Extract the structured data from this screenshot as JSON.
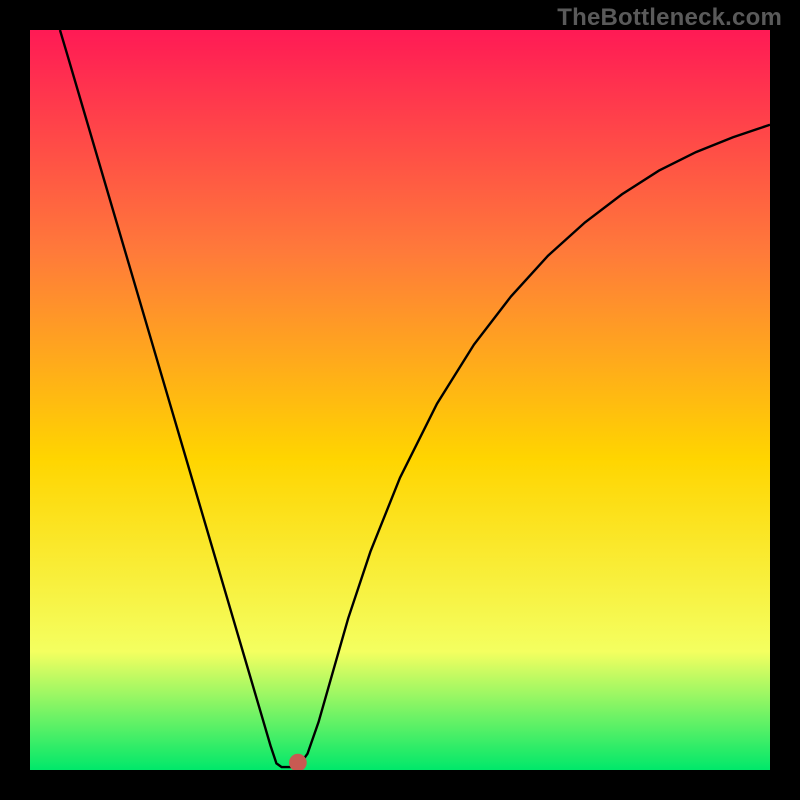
{
  "watermark": "TheBottleneck.com",
  "chart_data": {
    "type": "line",
    "title": "",
    "xlabel": "",
    "ylabel": "",
    "xlim": [
      0,
      100
    ],
    "ylim": [
      0,
      100
    ],
    "gradient_colors": {
      "top": "#ff1a55",
      "upper_mid": "#ff7a3a",
      "mid": "#ffd500",
      "lower_mid": "#f4ff60",
      "bottom": "#00e86a"
    },
    "series": [
      {
        "name": "curve",
        "stroke": "#000000",
        "stroke_width": 2.4,
        "points": [
          {
            "x": 4.05,
            "y": 100.0
          },
          {
            "x": 5.0,
            "y": 96.8
          },
          {
            "x": 7.0,
            "y": 90.0
          },
          {
            "x": 10.0,
            "y": 79.8
          },
          {
            "x": 13.0,
            "y": 69.6
          },
          {
            "x": 16.0,
            "y": 59.4
          },
          {
            "x": 19.0,
            "y": 49.2
          },
          {
            "x": 22.0,
            "y": 39.0
          },
          {
            "x": 25.0,
            "y": 28.8
          },
          {
            "x": 27.0,
            "y": 22.0
          },
          {
            "x": 29.0,
            "y": 15.2
          },
          {
            "x": 31.0,
            "y": 8.4
          },
          {
            "x": 32.5,
            "y": 3.3
          },
          {
            "x": 33.3,
            "y": 0.9
          },
          {
            "x": 34.0,
            "y": 0.4
          },
          {
            "x": 35.5,
            "y": 0.4
          },
          {
            "x": 36.5,
            "y": 0.8
          },
          {
            "x": 37.5,
            "y": 2.2
          },
          {
            "x": 39.0,
            "y": 6.5
          },
          {
            "x": 41.0,
            "y": 13.5
          },
          {
            "x": 43.0,
            "y": 20.5
          },
          {
            "x": 46.0,
            "y": 29.5
          },
          {
            "x": 50.0,
            "y": 39.5
          },
          {
            "x": 55.0,
            "y": 49.5
          },
          {
            "x": 60.0,
            "y": 57.5
          },
          {
            "x": 65.0,
            "y": 64.0
          },
          {
            "x": 70.0,
            "y": 69.5
          },
          {
            "x": 75.0,
            "y": 74.0
          },
          {
            "x": 80.0,
            "y": 77.8
          },
          {
            "x": 85.0,
            "y": 81.0
          },
          {
            "x": 90.0,
            "y": 83.5
          },
          {
            "x": 95.0,
            "y": 85.5
          },
          {
            "x": 100.0,
            "y": 87.2
          }
        ]
      }
    ],
    "marker": {
      "x": 36.2,
      "y": 1.0,
      "r": 1.2,
      "fill": "#c85a52"
    }
  }
}
